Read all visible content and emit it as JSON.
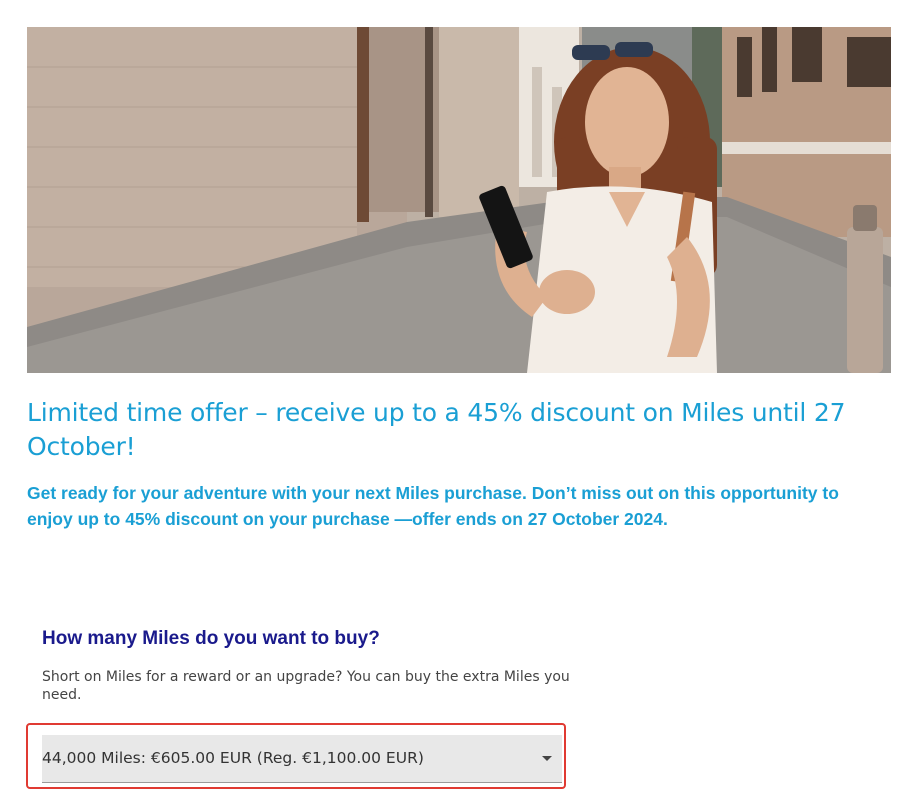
{
  "hero": {
    "alt": "Woman smiling while looking at her phone on a cobblestone street"
  },
  "offer": {
    "headline": "Limited time offer – receive up to a 45% discount on Miles until 27 October!",
    "subtext": "Get ready for your adventure with your next Miles purchase. Don’t miss out on this opportunity to enjoy up to 45% discount on your purchase —offer ends on 27 October 2024."
  },
  "buy": {
    "title": "How many Miles do you want to buy?",
    "description": "Short on Miles for a reward or an upgrade? You can buy the extra Miles you need.",
    "selected_option": "44,000 Miles: €605.00 EUR (Reg. €1,100.00 EUR)",
    "caret_icon": "chevron-down-icon"
  },
  "colors": {
    "accent": "#1a9fd4",
    "heading": "#1a1a8c",
    "highlight_border": "#e03a32",
    "select_bg": "#e8e8e8"
  }
}
